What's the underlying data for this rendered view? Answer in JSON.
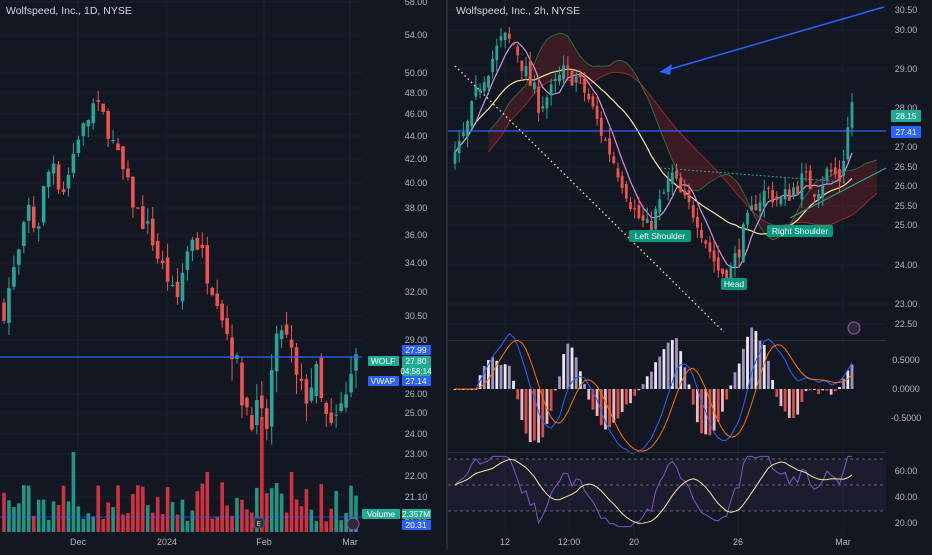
{
  "left_chart": {
    "title": "Wolfspeed, Inc., 1D, NYSE",
    "y_ticks": [
      "58.00",
      "54.00",
      "50.00",
      "48.00",
      "46.00",
      "44.00",
      "42.00",
      "40.00",
      "38.00",
      "36.00",
      "34.00",
      "32.00",
      "30.50",
      "29.00",
      "27.99",
      "26.00",
      "25.00",
      "24.00",
      "23.00",
      "22.00",
      "21.10",
      "20.00"
    ],
    "x_ticks": [
      "Dec",
      "2024",
      "Feb",
      "Mar"
    ],
    "labels": {
      "wolf_tag": "WOLF",
      "wolf_price": "27.80",
      "wolf_countdown": "04:58:14",
      "level": "27.99",
      "vwap_tag": "VWAP",
      "vwap_value": "27.14",
      "volume_tag": "Volume",
      "volume_value": "2.357M",
      "volume_ma": "20.31"
    },
    "colors": {
      "up": "#26a69a",
      "down": "#ef5350",
      "vol_up": "#22ab94",
      "vol_down": "#f23645",
      "line": "#2962ff",
      "wolf": "#22ab94",
      "vwap": "#2962ff"
    }
  },
  "right_chart": {
    "title": "Wolfspeed, Inc., 2h, NYSE",
    "y_ticks": [
      "30.50",
      "30.00",
      "29.00",
      "28.00",
      "27.00",
      "26.50",
      "26.00",
      "25.50",
      "25.00",
      "24.00",
      "23.00",
      "22.50"
    ],
    "price_labels": {
      "last": "28.15",
      "level": "27.41"
    },
    "x_ticks": [
      "12",
      "12:00",
      "20",
      "26",
      "Mar"
    ],
    "annotations": [
      "Left Shoulder",
      "Head",
      "Right Shoulder"
    ],
    "macd_ticks": [
      "0.5000",
      "0.0000",
      "-0.5000"
    ],
    "rsi_ticks": [
      "60.00",
      "40.00",
      "20.00"
    ],
    "colors": {
      "up": "#26a69a",
      "down": "#ef5350",
      "cloud_up": "#1b5e3a",
      "cloud_down": "#5b1f24",
      "annot": "#089981",
      "line": "#2962ff"
    }
  },
  "chart_data": [
    {
      "type": "candlestick",
      "title": "Wolfspeed, Inc., 1D, NYSE",
      "ylim": [
        19.5,
        58.5
      ],
      "x_categories": [
        "Dec",
        "2024",
        "Feb",
        "Mar"
      ],
      "close_path": [
        31,
        33,
        35,
        38,
        36,
        40,
        42,
        39,
        41,
        44,
        45,
        47,
        46,
        44,
        42,
        40,
        38,
        37,
        36,
        34,
        33,
        31,
        34,
        36,
        35,
        33,
        32,
        30,
        28,
        26,
        25,
        25,
        24,
        28,
        30,
        28,
        26,
        26,
        27,
        25,
        24,
        25,
        26,
        27.8
      ],
      "horizontal_line": 27.99,
      "vwap": 27.14,
      "last_price": 27.8,
      "volume": 2.357,
      "volume_unit": "M"
    },
    {
      "type": "candlestick",
      "title": "Wolfspeed, Inc., 2h, NYSE",
      "ylim": [
        22.3,
        30.7
      ],
      "close_path": [
        26.7,
        27.5,
        28.6,
        29.2,
        29.8,
        29.6,
        28.8,
        28.1,
        28.4,
        28.9,
        28.8,
        28.3,
        27.5,
        26.8,
        26.1,
        25.3,
        24.9,
        25.5,
        26.3,
        25.6,
        25.3,
        24.5,
        23.8,
        23.9,
        24.8,
        25.6,
        25.9,
        25.6,
        25.9,
        26.2,
        25.9,
        26.4,
        26.2,
        28.15
      ],
      "horizontal_line": 27.41,
      "last_price": 28.15,
      "pattern": [
        "Left Shoulder",
        "Head",
        "Right Shoulder"
      ],
      "macd_range": [
        -0.8,
        0.8
      ],
      "rsi_range": [
        15,
        75
      ]
    }
  ]
}
